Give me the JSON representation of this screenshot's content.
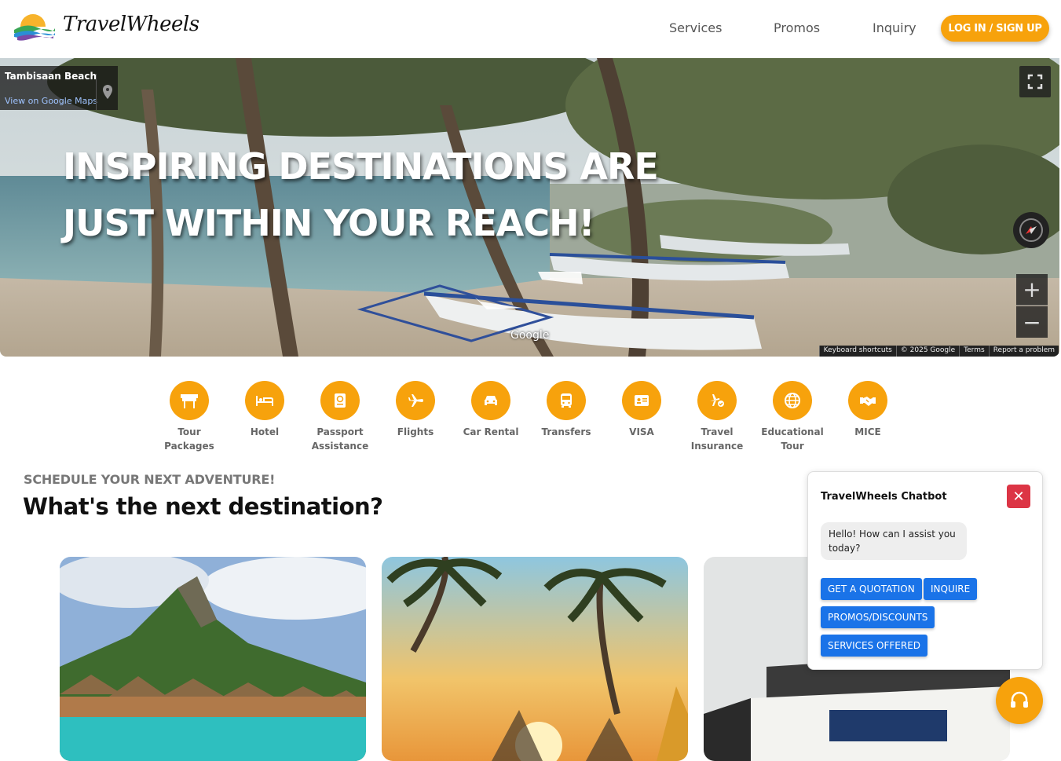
{
  "brand": {
    "name": "TravelWheels"
  },
  "nav": {
    "links": [
      "Services",
      "Promos",
      "Inquiry"
    ],
    "login_label": "LOG IN / SIGN UP"
  },
  "hero": {
    "place_name": "Tambisaan Beach",
    "place_link": "View on Google Maps",
    "title_line1": "INSPIRING DESTINATIONS ARE",
    "title_line2": "JUST WITHIN YOUR REACH!",
    "map_logo": "Google",
    "attributions": [
      "Keyboard shortcuts",
      "© 2025 Google",
      "Terms",
      "Report a problem"
    ]
  },
  "services": [
    {
      "label": "Tour Packages",
      "icon": "torii-gate-icon"
    },
    {
      "label": "Hotel",
      "icon": "bed-icon"
    },
    {
      "label": "Passport Assistance",
      "icon": "passport-icon"
    },
    {
      "label": "Flights",
      "icon": "plane-icon"
    },
    {
      "label": "Car Rental",
      "icon": "car-icon"
    },
    {
      "label": "Transfers",
      "icon": "bus-icon"
    },
    {
      "label": "VISA",
      "icon": "id-card-icon"
    },
    {
      "label": "Travel Insurance",
      "icon": "plane-shield-icon"
    },
    {
      "label": "Educational Tour",
      "icon": "globe-icon"
    },
    {
      "label": "MICE",
      "icon": "handshake-icon"
    }
  ],
  "section": {
    "eyebrow": "SCHEDULE YOUR NEXT ADVENTURE!",
    "title": "What's the next destination?"
  },
  "chatbot": {
    "title": "TravelWheels Chatbot",
    "close_label": "✕",
    "greeting": "Hello! How can I assist you today?",
    "options": [
      "GET A QUOTATION",
      "INQUIRE",
      "PROMOS/DISCOUNTS",
      "SERVICES OFFERED"
    ]
  },
  "colors": {
    "accent": "#f7a20c",
    "chat_button": "#1a73e8",
    "close": "#dc3545"
  }
}
